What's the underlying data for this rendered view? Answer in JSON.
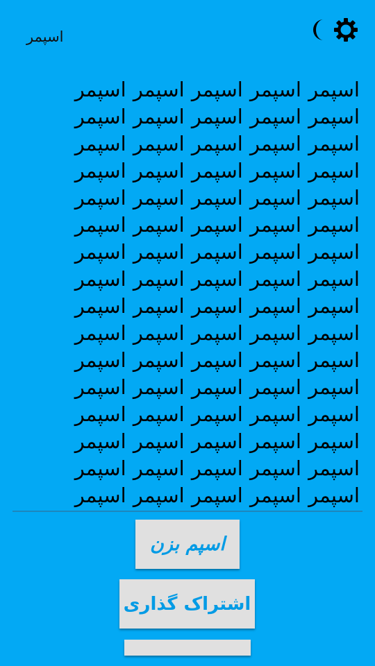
{
  "header": {
    "title": "اسپمر",
    "icons": [
      "moon-icon",
      "sun-icon"
    ]
  },
  "output": {
    "word": "اسپمر",
    "repeat_count": 82
  },
  "buttons": {
    "spam_label": "اسپم بزن",
    "share_label": "اشتراک گذاری",
    "extra_label": ""
  },
  "colors": {
    "background": "#03a9f4",
    "button_bg": "#e0e0e0",
    "button_text": "#039be5",
    "text": "#000000"
  }
}
